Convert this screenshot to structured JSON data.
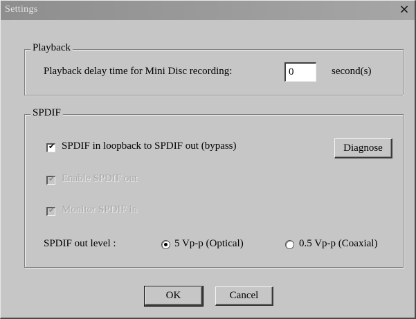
{
  "window": {
    "title": "Settings",
    "close_glyph": "×"
  },
  "playback": {
    "group_label": "Playback",
    "delay_label": "Playback delay time for Mini Disc recording:",
    "delay_value": "0",
    "unit_label": "second(s)"
  },
  "spdif": {
    "group_label": "SPDIF",
    "loopback_label": "SPDIF in loopback to SPDIF out (bypass)",
    "loopback_checked": true,
    "diagnose_label": "Diagnose",
    "enable_out_label": "Enable SPDIF out",
    "enable_out_checked": true,
    "monitor_in_label": "Monitor SPDIF in",
    "monitor_in_checked": true,
    "out_level_label": "SPDIF out level :",
    "option_optical_label": "5 Vp-p (Optical)",
    "option_coaxial_label": "0.5 Vp-p (Coaxial)",
    "selected_level": "5 Vp-p (Optical)"
  },
  "buttons": {
    "ok_label": "OK",
    "cancel_label": "Cancel"
  },
  "icons": {
    "check": "check-icon",
    "close": "close-icon"
  }
}
